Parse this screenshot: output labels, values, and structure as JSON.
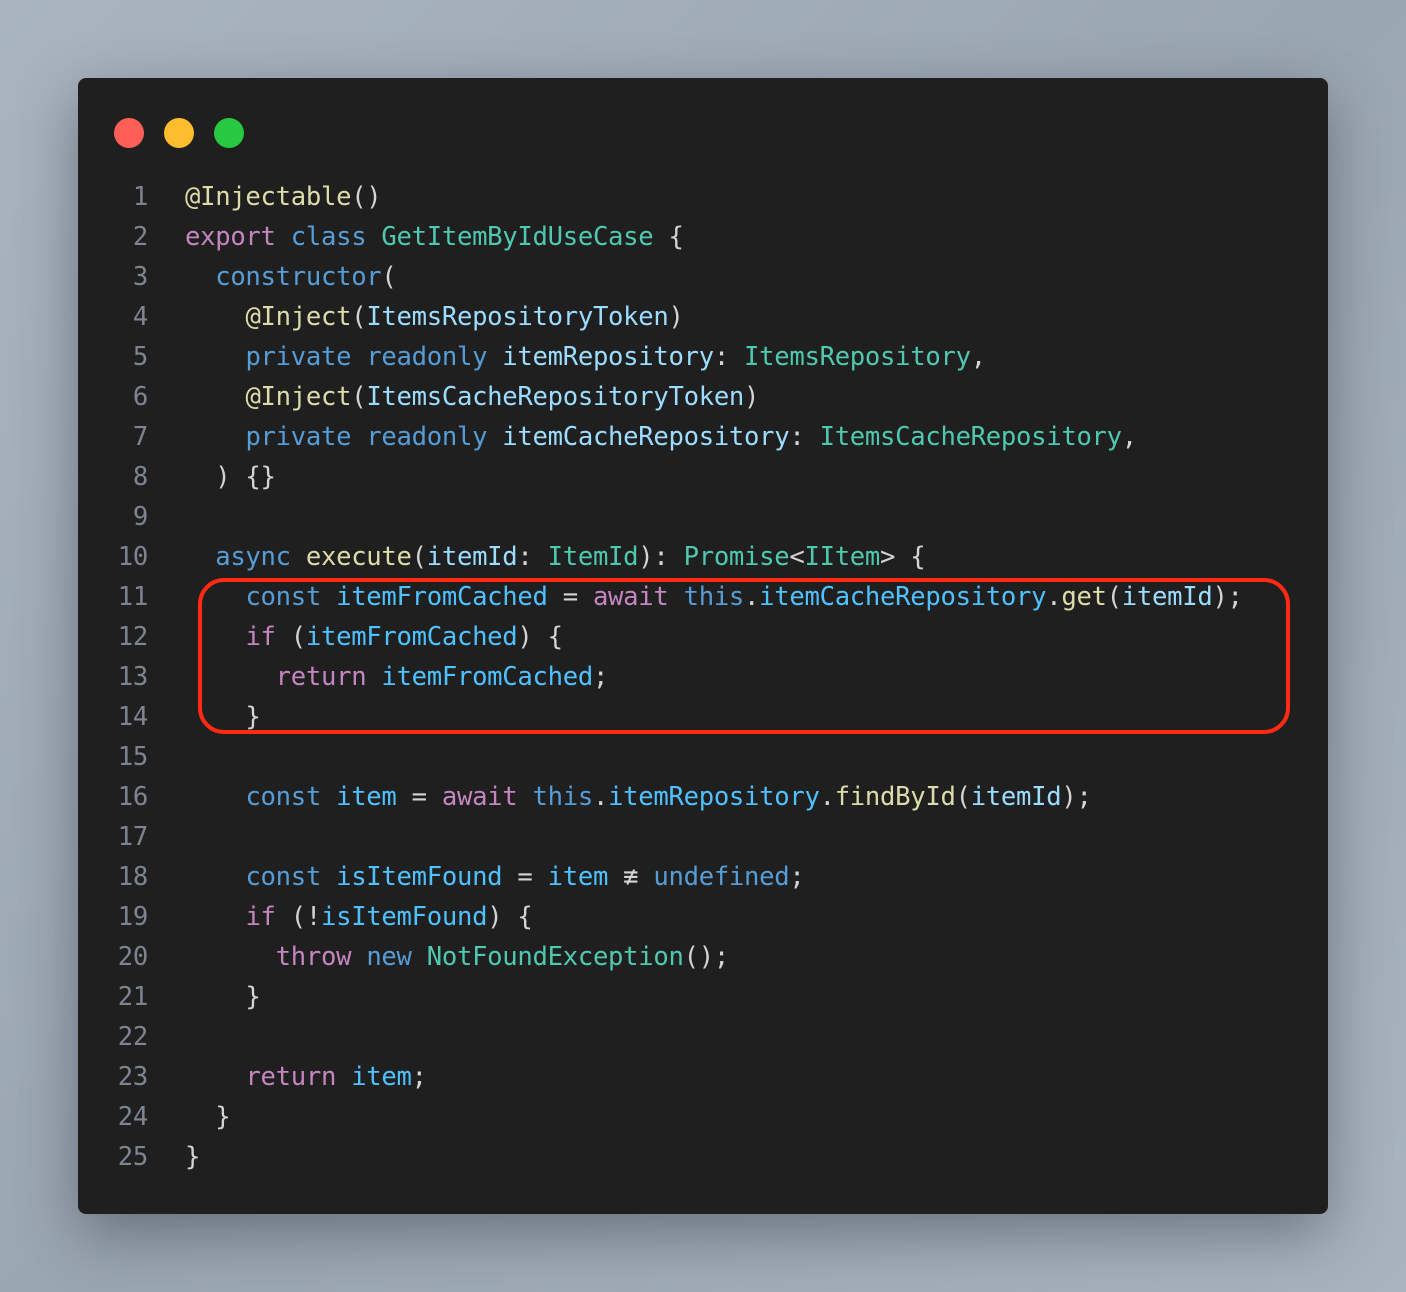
{
  "window": {
    "controls": [
      {
        "name": "close",
        "color": "#ff5f57"
      },
      {
        "name": "minimize",
        "color": "#febc2e"
      },
      {
        "name": "maximize",
        "color": "#28c840"
      }
    ]
  },
  "colors": {
    "background": "#1f1f1f",
    "line_number": "#7d8590",
    "highlight_border": "#ff2a12",
    "tokens": {
      "kw": "#c586c0",
      "st": "#569cd6",
      "ty": "#4ec9b0",
      "fn": "#dcdcaa",
      "va": "#4fc1ff",
      "pa": "#9cdcfe",
      "pu": "#d4d4d4"
    }
  },
  "highlight": {
    "from_line": 11,
    "to_line": 14
  },
  "lines": [
    {
      "n": "1",
      "tokens": [
        [
          "fn",
          "@Injectable"
        ],
        [
          "pu",
          "()"
        ]
      ]
    },
    {
      "n": "2",
      "tokens": [
        [
          "kw",
          "export"
        ],
        [
          "pu",
          " "
        ],
        [
          "st",
          "class"
        ],
        [
          "pu",
          " "
        ],
        [
          "ty",
          "GetItemByIdUseCase"
        ],
        [
          "pu",
          " {"
        ]
      ]
    },
    {
      "n": "3",
      "tokens": [
        [
          "pu",
          "  "
        ],
        [
          "st",
          "constructor"
        ],
        [
          "pu",
          "("
        ]
      ]
    },
    {
      "n": "4",
      "tokens": [
        [
          "pu",
          "    "
        ],
        [
          "fn",
          "@Inject"
        ],
        [
          "pu",
          "("
        ],
        [
          "pa",
          "ItemsRepositoryToken"
        ],
        [
          "pu",
          ")"
        ]
      ]
    },
    {
      "n": "5",
      "tokens": [
        [
          "pu",
          "    "
        ],
        [
          "st",
          "private"
        ],
        [
          "pu",
          " "
        ],
        [
          "st",
          "readonly"
        ],
        [
          "pu",
          " "
        ],
        [
          "pa",
          "itemRepository"
        ],
        [
          "pu",
          ": "
        ],
        [
          "ty",
          "ItemsRepository"
        ],
        [
          "pu",
          ","
        ]
      ]
    },
    {
      "n": "6",
      "tokens": [
        [
          "pu",
          "    "
        ],
        [
          "fn",
          "@Inject"
        ],
        [
          "pu",
          "("
        ],
        [
          "pa",
          "ItemsCacheRepositoryToken"
        ],
        [
          "pu",
          ")"
        ]
      ]
    },
    {
      "n": "7",
      "tokens": [
        [
          "pu",
          "    "
        ],
        [
          "st",
          "private"
        ],
        [
          "pu",
          " "
        ],
        [
          "st",
          "readonly"
        ],
        [
          "pu",
          " "
        ],
        [
          "pa",
          "itemCacheRepository"
        ],
        [
          "pu",
          ": "
        ],
        [
          "ty",
          "ItemsCacheRepository"
        ],
        [
          "pu",
          ","
        ]
      ]
    },
    {
      "n": "8",
      "tokens": [
        [
          "pu",
          "  ) {}"
        ]
      ]
    },
    {
      "n": "9",
      "tokens": []
    },
    {
      "n": "10",
      "tokens": [
        [
          "pu",
          "  "
        ],
        [
          "st",
          "async"
        ],
        [
          "pu",
          " "
        ],
        [
          "fn",
          "execute"
        ],
        [
          "pu",
          "("
        ],
        [
          "pa",
          "itemId"
        ],
        [
          "pu",
          ": "
        ],
        [
          "ty",
          "ItemId"
        ],
        [
          "pu",
          "): "
        ],
        [
          "ty",
          "Promise"
        ],
        [
          "pu",
          "<"
        ],
        [
          "ty",
          "IItem"
        ],
        [
          "pu",
          "> {"
        ]
      ]
    },
    {
      "n": "11",
      "tokens": [
        [
          "pu",
          "    "
        ],
        [
          "st",
          "const"
        ],
        [
          "pu",
          " "
        ],
        [
          "va",
          "itemFromCached"
        ],
        [
          "pu",
          " = "
        ],
        [
          "kw",
          "await"
        ],
        [
          "pu",
          " "
        ],
        [
          "st",
          "this"
        ],
        [
          "pu",
          "."
        ],
        [
          "va",
          "itemCacheRepository"
        ],
        [
          "pu",
          "."
        ],
        [
          "fn",
          "get"
        ],
        [
          "pu",
          "("
        ],
        [
          "pa",
          "itemId"
        ],
        [
          "pu",
          ");"
        ]
      ]
    },
    {
      "n": "12",
      "tokens": [
        [
          "pu",
          "    "
        ],
        [
          "kw",
          "if"
        ],
        [
          "pu",
          " ("
        ],
        [
          "va",
          "itemFromCached"
        ],
        [
          "pu",
          ") {"
        ]
      ]
    },
    {
      "n": "13",
      "tokens": [
        [
          "pu",
          "      "
        ],
        [
          "kw",
          "return"
        ],
        [
          "pu",
          " "
        ],
        [
          "va",
          "itemFromCached"
        ],
        [
          "pu",
          ";"
        ]
      ]
    },
    {
      "n": "14",
      "tokens": [
        [
          "pu",
          "    }"
        ]
      ]
    },
    {
      "n": "15",
      "tokens": []
    },
    {
      "n": "16",
      "tokens": [
        [
          "pu",
          "    "
        ],
        [
          "st",
          "const"
        ],
        [
          "pu",
          " "
        ],
        [
          "va",
          "item"
        ],
        [
          "pu",
          " = "
        ],
        [
          "kw",
          "await"
        ],
        [
          "pu",
          " "
        ],
        [
          "st",
          "this"
        ],
        [
          "pu",
          "."
        ],
        [
          "va",
          "itemRepository"
        ],
        [
          "pu",
          "."
        ],
        [
          "fn",
          "findById"
        ],
        [
          "pu",
          "("
        ],
        [
          "pa",
          "itemId"
        ],
        [
          "pu",
          ");"
        ]
      ]
    },
    {
      "n": "17",
      "tokens": []
    },
    {
      "n": "18",
      "tokens": [
        [
          "pu",
          "    "
        ],
        [
          "st",
          "const"
        ],
        [
          "pu",
          " "
        ],
        [
          "va",
          "isItemFound"
        ],
        [
          "pu",
          " = "
        ],
        [
          "va",
          "item"
        ],
        [
          "pu",
          " ≢ "
        ],
        [
          "st",
          "undefined"
        ],
        [
          "pu",
          ";"
        ]
      ]
    },
    {
      "n": "19",
      "tokens": [
        [
          "pu",
          "    "
        ],
        [
          "kw",
          "if"
        ],
        [
          "pu",
          " (!"
        ],
        [
          "va",
          "isItemFound"
        ],
        [
          "pu",
          ") {"
        ]
      ]
    },
    {
      "n": "20",
      "tokens": [
        [
          "pu",
          "      "
        ],
        [
          "kw",
          "throw"
        ],
        [
          "pu",
          " "
        ],
        [
          "st",
          "new"
        ],
        [
          "pu",
          " "
        ],
        [
          "ty",
          "NotFoundException"
        ],
        [
          "pu",
          "();"
        ]
      ]
    },
    {
      "n": "21",
      "tokens": [
        [
          "pu",
          "    }"
        ]
      ]
    },
    {
      "n": "22",
      "tokens": []
    },
    {
      "n": "23",
      "tokens": [
        [
          "pu",
          "    "
        ],
        [
          "kw",
          "return"
        ],
        [
          "pu",
          " "
        ],
        [
          "va",
          "item"
        ],
        [
          "pu",
          ";"
        ]
      ]
    },
    {
      "n": "24",
      "tokens": [
        [
          "pu",
          "  }"
        ]
      ]
    },
    {
      "n": "25",
      "tokens": [
        [
          "pu",
          "}"
        ]
      ]
    }
  ]
}
